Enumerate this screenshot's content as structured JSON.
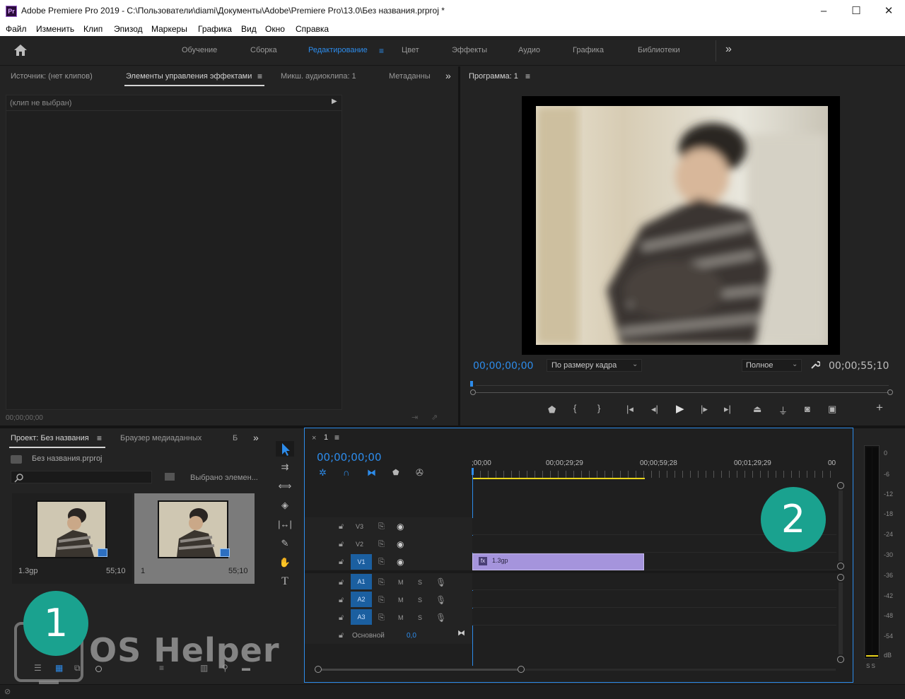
{
  "window": {
    "title": "Adobe Premiere Pro 2019 - C:\\Пользователи\\diami\\Документы\\Adobe\\Premiere Pro\\13.0\\Без названия.prproj *",
    "app_icon": "Pr",
    "min": "–",
    "max": "☐",
    "close": "✕"
  },
  "menu": [
    "Файл",
    "Изменить",
    "Клип",
    "Эпизод",
    "Маркеры",
    "Графика",
    "Вид",
    "Окно",
    "Справка"
  ],
  "workspaces": {
    "items": [
      "Обучение",
      "Сборка",
      "Редактирование",
      "Цвет",
      "Эффекты",
      "Аудио",
      "Графика",
      "Библиотеки"
    ],
    "active": "Редактирование",
    "more": "»"
  },
  "source_panel": {
    "tabs": [
      "Источник: (нет клипов)",
      "Элементы управления эффектами",
      "Микш. аудиоклипа: 1",
      "Метаданны"
    ],
    "active_tab": "Элементы управления эффектами",
    "no_clip": "(клип не выбран)",
    "timecode": "00;00;00;00",
    "menu_icon": "≡",
    "more": "»"
  },
  "program_monitor": {
    "title": "Программа: 1",
    "menu_icon": "≡",
    "timecode": "00;00;00;00",
    "fit": "По размеру кадра",
    "quality": "Полное",
    "duration": "00;00;55;10",
    "add": "+"
  },
  "project_panel": {
    "tabs": [
      "Проект: Без названия",
      "Браузер медиаданных",
      "Б"
    ],
    "active_tab": "Проект: Без названия",
    "file": "Без названия.prproj",
    "search_placeholder": "",
    "selected_info": "Выбрано элемен...",
    "items": [
      {
        "name": "1.3gp",
        "duration": "55;10"
      },
      {
        "name": "1",
        "duration": "55;10"
      }
    ],
    "menu_icon": "≡",
    "more": "»"
  },
  "timeline": {
    "close": "×",
    "sequence": "1",
    "menu_icon": "≡",
    "timecode": "00;00;00;00",
    "ruler": [
      ";00;00",
      "00;00;29;29",
      "00;00;59;28",
      "00;01;29;29",
      "00"
    ],
    "video_tracks": [
      "V3",
      "V2",
      "V1"
    ],
    "audio_tracks": [
      "A1",
      "A2",
      "A3"
    ],
    "mute": "M",
    "solo": "S",
    "master_label": "Основной",
    "master_value": "0,0",
    "clip_name": "1.3gp",
    "clip_fx": "fx"
  },
  "meter": {
    "labels": [
      "0",
      "-6",
      "-12",
      "-18",
      "-24",
      "-30",
      "-36",
      "-42",
      "-48",
      "-54",
      "dB"
    ],
    "solo_buttons": "S S"
  },
  "overlays": {
    "badge1": "1",
    "badge2": "2",
    "watermark": "OS Helper"
  },
  "colors": {
    "accent": "#2d8ceb",
    "clip": "#a594dc",
    "badge": "#1aa28f",
    "track_target": "#1b5fa0",
    "in_out_bar": "#e8d31a"
  }
}
